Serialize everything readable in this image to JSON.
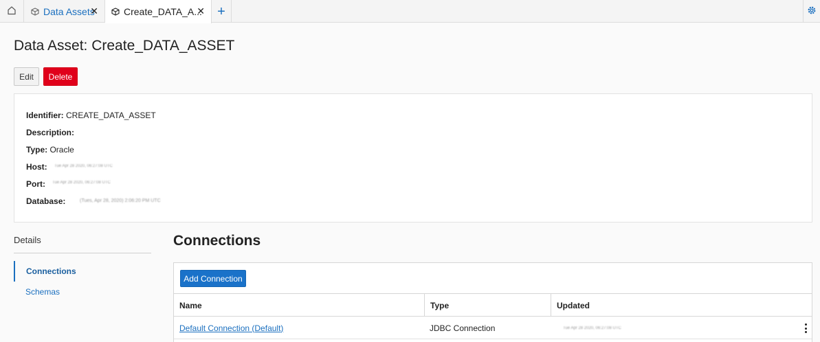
{
  "tabs": {
    "home_label": "Home",
    "items": [
      {
        "label": "Data Assets",
        "icon": "cube-icon",
        "closable": true
      },
      {
        "label": "Create_DATA_A...",
        "icon": "cube-icon",
        "closable": true,
        "active": true
      }
    ],
    "close_glyph": "✕",
    "add_glyph": "+"
  },
  "header": {
    "title": "Data Asset: Create_DATA_ASSET",
    "edit_label": "Edit",
    "delete_label": "Delete"
  },
  "info": {
    "identifier_label": "Identifier:",
    "identifier_value": "CREATE_DATA_ASSET",
    "description_label": "Description:",
    "description_value": "",
    "type_label": "Type:",
    "type_value": "Oracle",
    "host_label": "Host:",
    "host_value": "Tue Apr 28 2020, 06:27:08 UTC",
    "port_label": "Port:",
    "port_value": "Tue Apr 28 2020, 06:27:08 UTC",
    "database_label": "Database:",
    "database_value": "(Tues, Apr 28, 2020) 2:06:20 PM UTC"
  },
  "nav": {
    "title": "Details",
    "items": [
      {
        "label": "Connections",
        "active": true
      },
      {
        "label": "Schemas",
        "active": false
      }
    ]
  },
  "connections": {
    "title": "Connections",
    "add_label": "Add Connection",
    "columns": [
      "Name",
      "Type",
      "Updated"
    ],
    "rows": [
      {
        "name": "Default Connection (Default)",
        "type": "JDBC Connection",
        "updated": "Tue Apr 28 2020, 06:27:08 UTC"
      }
    ]
  },
  "colors": {
    "accent": "#1a72c9",
    "danger": "#e0001b",
    "link": "#1a6fbf"
  }
}
